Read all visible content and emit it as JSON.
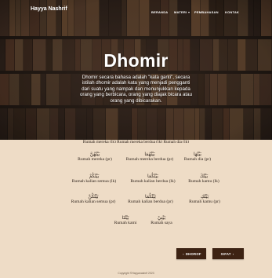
{
  "navbar": {
    "brand": "Hayya Nashrif",
    "links": [
      {
        "label": "BERANDA"
      },
      {
        "label": "MATERI"
      },
      {
        "label": "PEMBAHASAN"
      },
      {
        "label": "KONTAK"
      }
    ]
  },
  "hero": {
    "title": "Dhomir",
    "description": "Dhomir secara bahasa adalah \"kata ganti\", secara istilah dhomir adalah kata yang menjadi pengganti dari suatu yang nampak dan menunjukkan kepada orang yang berbicara, orang yang diajak bicara atau orang yang dibicarakan."
  },
  "words": {
    "cut_row": "Rumah mereka (lk) Rumah mereka berdua (lk) Rumah dia (lk)",
    "rows": [
      [
        {
          "arabic": "بَيْتُهُنَّ",
          "translation": "Rumah mereka (pr)"
        },
        {
          "arabic": "بَيْتُهُمَا",
          "translation": "Rumah mereka berdua (pr)"
        },
        {
          "arabic": "بَيْتُهَا",
          "translation": "Rumah dia (pr)"
        }
      ],
      [
        {
          "arabic": "بَيْتُكُمْ",
          "translation": "Rumah kalian semua (lk)"
        },
        {
          "arabic": "بَيْتُكُمَا",
          "translation": "Rumah kalian berdua (lk)"
        },
        {
          "arabic": "بَيْتُكَ",
          "translation": "Rumah kamu (lk)"
        }
      ],
      [
        {
          "arabic": "بَيْتُكُنَّ",
          "translation": "Rumah kalian semua (pr)"
        },
        {
          "arabic": "بَيْتُكُمَا",
          "translation": "Rumah kalian berdua (pr)"
        },
        {
          "arabic": "بَيْتُكِ",
          "translation": "Rumah kamu (pr)"
        }
      ],
      [
        {
          "arabic": "بَيْتُنَا",
          "translation": "Rumah kami"
        },
        {
          "arabic": "بَيْتِيْ",
          "translation": "Rumah saya"
        }
      ]
    ]
  },
  "buttons": {
    "prev": "DHOROF",
    "next": "SIFAT"
  },
  "footer": {
    "text": "Copyright ©Hayyanashrif 2023"
  },
  "colors": {
    "page_bg": "#eedcc6",
    "button_bg": "#3d2313",
    "text": "#2a1f18"
  }
}
